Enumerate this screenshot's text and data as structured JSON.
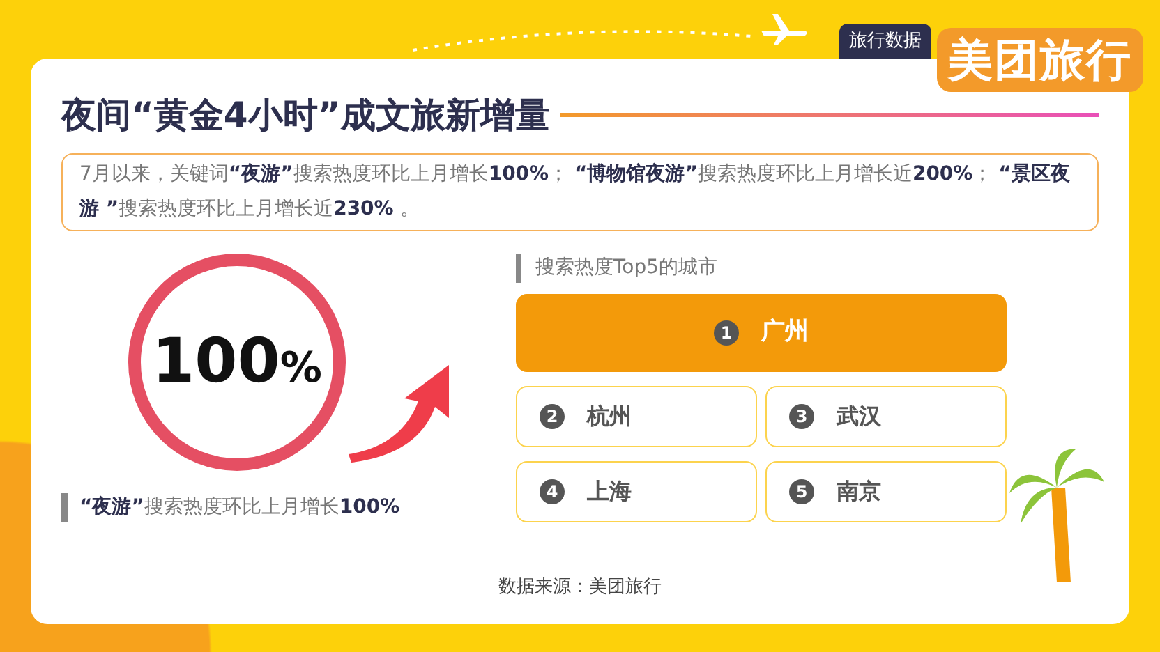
{
  "header": {
    "tag": "旅行数据",
    "logo": "美团旅行"
  },
  "title": "夜间“黄金4小时”成文旅新增量",
  "summary": "7月以来，关键词**“夜游”**搜索热度环比上月增长**100%**； **“博物馆夜游”**搜索热度环比上月增长近**200%**； **“景区夜游 ”**搜索热度环比上月增长近**230%** 。",
  "highlight": {
    "value": "100",
    "unit": "%",
    "caption": "**“夜游”**搜索热度环比上月增长**100%**"
  },
  "ranking": {
    "heading": "搜索热度Top5的城市",
    "cities": [
      {
        "rank": "1",
        "name": "广州",
        "kind": "top"
      },
      {
        "rank": "2",
        "name": "杭州",
        "kind": "other"
      },
      {
        "rank": "3",
        "name": "武汉",
        "kind": "other"
      },
      {
        "rank": "4",
        "name": "上海",
        "kind": "other"
      },
      {
        "rank": "5",
        "name": "南京",
        "kind": "other"
      }
    ]
  },
  "source": "数据来源：美团旅行"
}
